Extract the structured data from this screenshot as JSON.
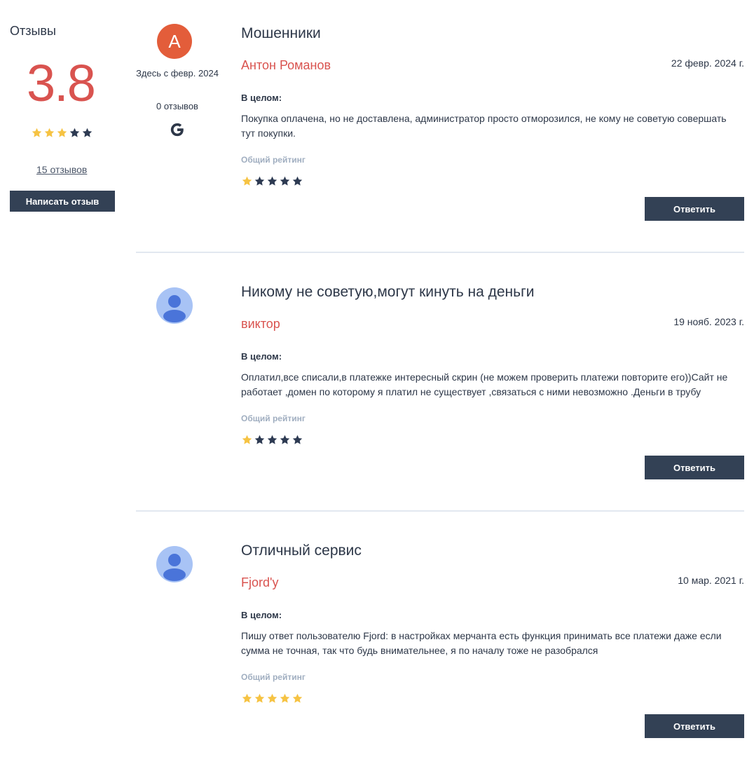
{
  "summary": {
    "title": "Отзывы",
    "score": "3.8",
    "rating": 3,
    "count_link": "15 отзывов",
    "write_button": "Написать отзыв"
  },
  "labels": {
    "overall": "В целом:",
    "rating_label": "Общий рейтинг",
    "reply_button": "Ответить"
  },
  "colors": {
    "accent_red": "#d9534f",
    "star_gold": "#f6c343",
    "star_dark": "#2d3a52",
    "button_dark": "#334155"
  },
  "reviews": [
    {
      "avatar_type": "letter",
      "avatar_letter": "A",
      "member_since": "Здесь с февр. 2024",
      "review_count": "0 отзывов",
      "source_icon": "google-icon",
      "title": "Мошенники",
      "author": "Антон Романов",
      "date": "22 февр. 2024 г.",
      "text": "Покупка оплачена, но не доставлена, администратор просто отморозился, не кому не советую совершать тут покупки.",
      "rating": 1
    },
    {
      "avatar_type": "person",
      "title": "Никому не советую,могут кинуть на деньги",
      "author": "виктор",
      "date": "19 нояб. 2023 г.",
      "text": "Оплатил,все списали,в платежке интересный скрин (не можем проверить платежи повторите его))Сайт не работает ,домен по которому я платил не существует ,связаться с ними невозможно .Деньги в трубу",
      "rating": 1
    },
    {
      "avatar_type": "person",
      "title": "Отличный сервис",
      "author": "Fjord'y",
      "date": "10 мар. 2021 г.",
      "text": "Пишу ответ пользователю Fjord: в настройках мерчанта есть функция принимать все платежи даже если сумма не точная, так что будь внимательнее, я по началу тоже не разобрался",
      "rating": 5
    }
  ]
}
